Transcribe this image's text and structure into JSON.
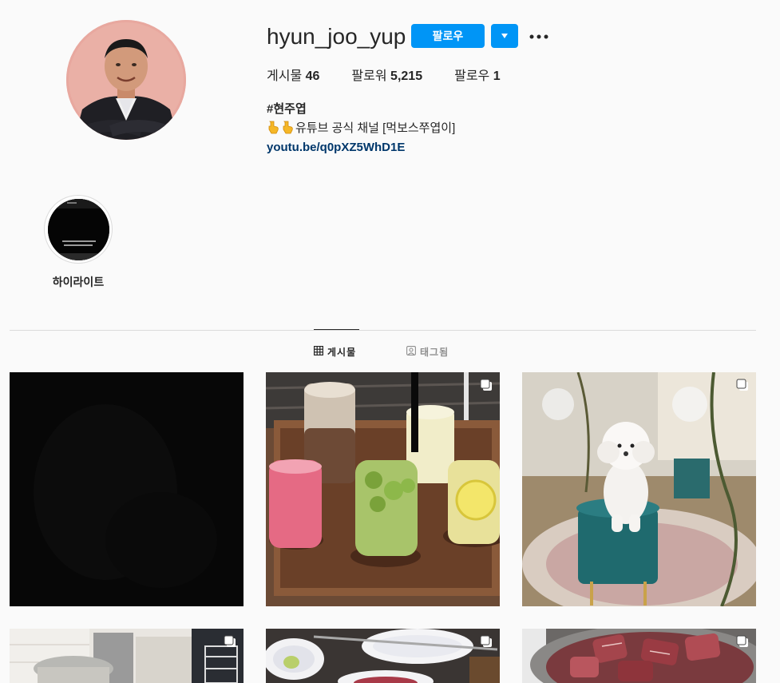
{
  "profile": {
    "username": "hyun_joo_yup",
    "follow_label": "팔로우",
    "stats": [
      {
        "label": "게시물",
        "value": "46"
      },
      {
        "label": "팔로워",
        "value": "5,215"
      },
      {
        "label": "팔로우",
        "value": "1"
      }
    ],
    "bio": {
      "name": "#현주엽",
      "line": "유튜브 공식 채널 [먹보스쭈엽이]",
      "link": "youtu.be/q0pXZ5WhD1E"
    }
  },
  "highlights": [
    {
      "label": "하이라이트"
    }
  ],
  "tabs": {
    "posts": "게시물",
    "tagged": "태그됨"
  },
  "colors": {
    "accent": "#0095f6",
    "link": "#00376b",
    "background": "#fafafa"
  },
  "icons": {
    "dropdown": "caret-down-icon",
    "more": "more-dots-icon",
    "posts_tab": "grid-icon",
    "tagged_tab": "tag-person-icon",
    "multi_post": "carousel-icon"
  }
}
